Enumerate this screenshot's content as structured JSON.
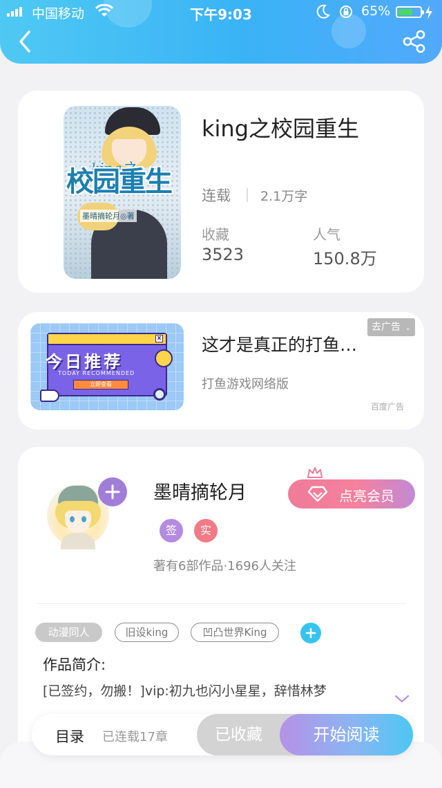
{
  "status_bar": {
    "carrier": "中国移动",
    "time": "下午9:03",
    "battery": "65%",
    "battery_level": 0.65
  },
  "book": {
    "title": "king之校园重生",
    "status": "连载",
    "word_count": "2.1万字",
    "favorites_label": "收藏",
    "favorites_value": "3523",
    "popularity_label": "人气",
    "popularity_value": "150.8万",
    "cover": {
      "king": "king之",
      "title": "校园重生",
      "author": "墨晴摘轮月◎著"
    }
  },
  "ad": {
    "title": "这才是真正的打鱼…",
    "subtitle": "打鱼游戏网络版",
    "remove_label": "去广告",
    "source": "百度广告",
    "image_text": "今日推荐",
    "image_sub": "TODAY RECOMMENDED",
    "image_button": "立即查看"
  },
  "author": {
    "name": "墨晴摘轮月",
    "vip_label": "点亮会员",
    "badges": [
      {
        "text": "签",
        "color": "#b48be0"
      },
      {
        "text": "实",
        "color": "#f07a85"
      }
    ],
    "stats": "著有6部作品·1696人关注"
  },
  "tags": [
    "动漫同人",
    "旧设king",
    "凹凸世界King"
  ],
  "intro": {
    "label": "作品简介:",
    "text": "[已签约，勿搬！]vip:初九也闪小星星，辞惜林梦"
  },
  "bottom_bar": {
    "toc_label": "目录",
    "chapters": "已连载17章",
    "collected_label": "已收藏",
    "read_label": "开始阅读"
  },
  "colors": {
    "header_blue": "#3ab3f6",
    "vip_pink": "#f07b98",
    "tag_add_blue": "#37c3ef",
    "follow_purple": "#a07ed8"
  }
}
